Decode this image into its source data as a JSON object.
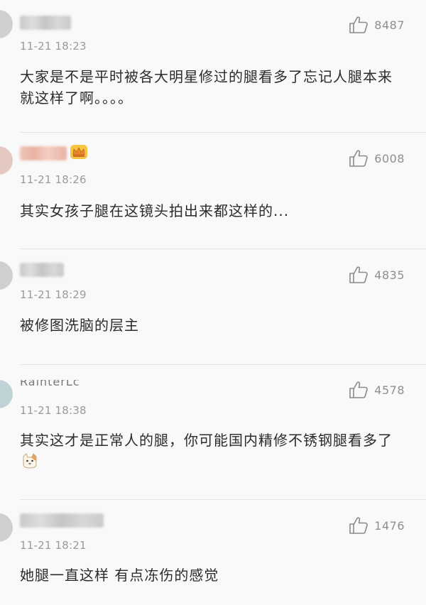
{
  "comments": [
    {
      "time": "11-21 18:23",
      "likes": "8487",
      "text": "大家是不是平时被各大明星修过的腿看多了忘记人腿本来就这样了啊。。。。"
    },
    {
      "time": "11-21 18:26",
      "likes": "6008",
      "text": "其实女孩子腿在这镜头拍出来都这样的..."
    },
    {
      "time": "11-21 18:29",
      "likes": "4835",
      "text": "被修图洗脑的层主"
    },
    {
      "time": "11-21 18:38",
      "likes": "4578",
      "text": "其实这才是正常人的腿，你可能国内精修不锈钢腿看多了",
      "username_partial": "RainterLc"
    },
    {
      "time": "11-21 18:21",
      "likes": "1476",
      "text": "她腿一直这样 有点冻伤的感觉"
    }
  ],
  "icons": {
    "like": "thumbs-up-icon",
    "crown": "crown-badge-icon",
    "emoji": "cat-face-emoji"
  },
  "colors": {
    "background": "#f9f9f9",
    "text": "#2b2b2b",
    "meta": "#9a9a9a",
    "like_count": "#8f8f8f"
  }
}
